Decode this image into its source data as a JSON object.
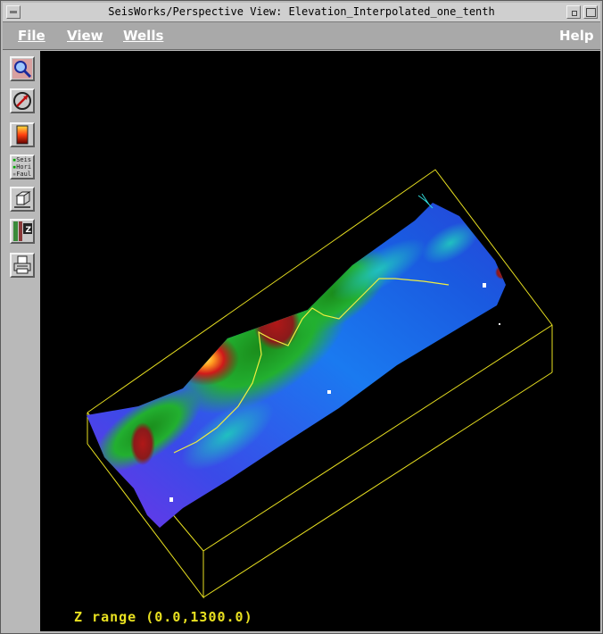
{
  "window": {
    "title": "SeisWorks/Perspective View: Elevation_Interpolated_one_tenth"
  },
  "menu": {
    "file": "File",
    "view": "View",
    "wells": "Wells",
    "help": "Help"
  },
  "toolbar": {
    "tools": [
      {
        "icon": "zoom-icon"
      },
      {
        "icon": "rotate-icon"
      },
      {
        "icon": "color-bar-icon"
      },
      {
        "icon": "layer-toggle-icon",
        "labels": [
          "Seis",
          "Hori",
          "Faul"
        ]
      },
      {
        "icon": "box-view-icon"
      },
      {
        "icon": "z-scale-icon",
        "label": "Z"
      },
      {
        "icon": "print-icon"
      }
    ]
  },
  "viewport": {
    "z_range_label": "Z range (0.0,1300.0)",
    "colors": {
      "background": "#000000",
      "bounding_box": "#e8e020",
      "well_path": "#f0ee40"
    }
  }
}
